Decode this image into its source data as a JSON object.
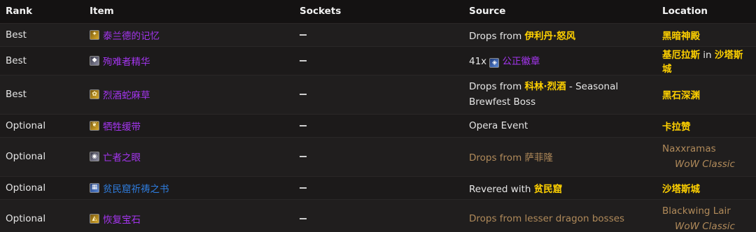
{
  "headers": {
    "rank": "Rank",
    "item": "Item",
    "sockets": "Sockets",
    "source": "Source",
    "location": "Location"
  },
  "rows": [
    {
      "rank": "Best",
      "item": "泰兰德的记忆",
      "item_icon": "gold-trinket-icon",
      "source_pre": "Drops from ",
      "source_link": "伊利丹·怒风",
      "location": "黑暗神殿"
    },
    {
      "rank": "Best",
      "item": "殉难者精华",
      "item_icon": "gray-trinket-icon",
      "source_pre": "41x ",
      "source_link": "公正徽章",
      "location_a": "基厄拉斯",
      "location_in": " in ",
      "location_b": "沙塔斯城"
    },
    {
      "rank": "Best",
      "item": "烈酒蛇麻草",
      "item_icon": "gold-trinket-icon",
      "source_pre": "Drops from ",
      "source_link": "科林·烈酒",
      "source_post": " - Seasonal",
      "source_line2": "Brewfest Boss",
      "location": "黑石深渊"
    },
    {
      "rank": "Optional",
      "item": "牺牲缓带",
      "item_icon": "gold-trinket-icon",
      "source": "Opera Event",
      "location": "卡拉赞"
    },
    {
      "rank": "Optional",
      "item": "亡者之眼",
      "item_icon": "gray-trinket-icon",
      "source_pre": "Drops from ",
      "source_link": "萨菲隆",
      "location": "Naxxramas",
      "location_sub": "WoW Classic"
    },
    {
      "rank": "Optional",
      "item": "贫民窟祈祷之书",
      "item_icon": "blue-trinket-icon",
      "source_pre": "Revered with ",
      "source_link": "贫民窟",
      "location": "沙塔斯城"
    },
    {
      "rank": "Optional",
      "item": "恢复宝石",
      "item_icon": "gold-trinket-icon",
      "source": "Drops from lesser dragon bosses",
      "location": "Blackwing Lair",
      "location_sub": "WoW Classic"
    }
  ]
}
